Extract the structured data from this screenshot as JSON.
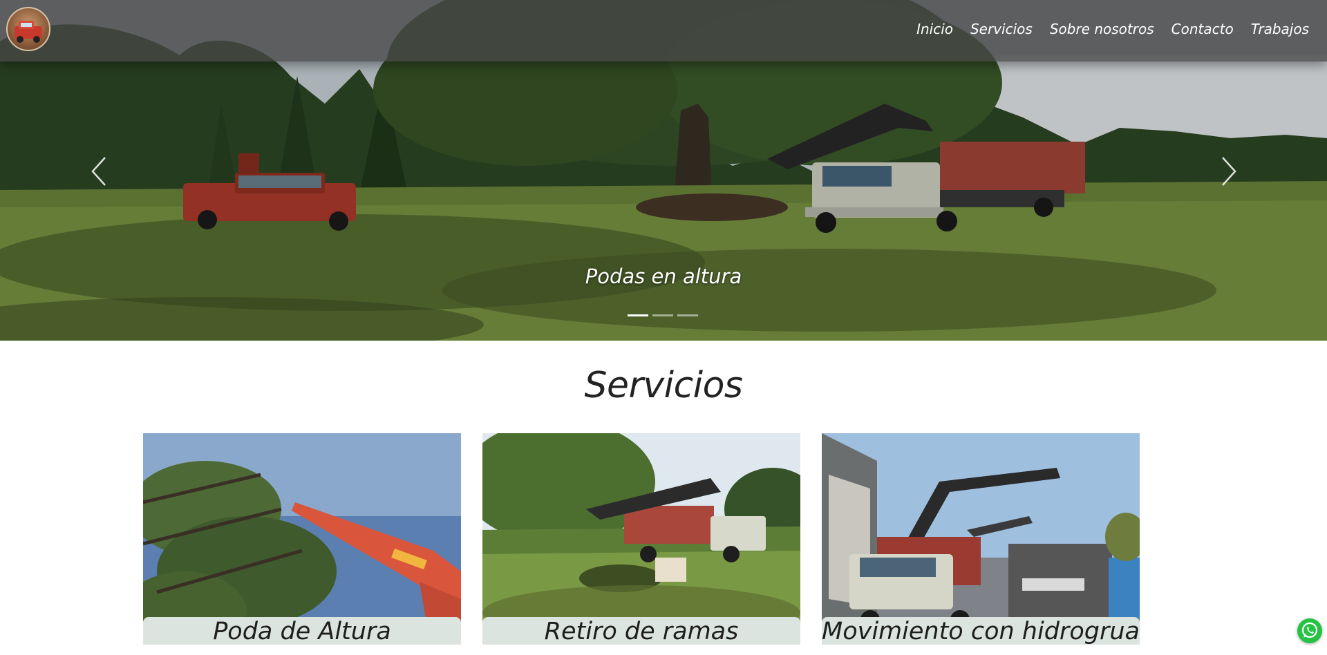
{
  "nav": {
    "logo_icon": "fire-truck-logo-icon",
    "links": [
      "Inicio",
      "Servicios",
      "Sobre nosotros",
      "Contacto",
      "Trabajos"
    ]
  },
  "carousel": {
    "caption": "Podas en altura",
    "prev_icon": "chevron-left-icon",
    "next_icon": "chevron-right-icon",
    "indicator_count": 3,
    "active_index": 0
  },
  "services": {
    "title": "Servicios",
    "cards": [
      {
        "label": "Poda de Altura"
      },
      {
        "label": "Retiro de ramas"
      },
      {
        "label": "Movimiento con hidrogrua"
      }
    ]
  },
  "whatsapp": {
    "icon": "whatsapp-icon",
    "color": "#25c244"
  }
}
